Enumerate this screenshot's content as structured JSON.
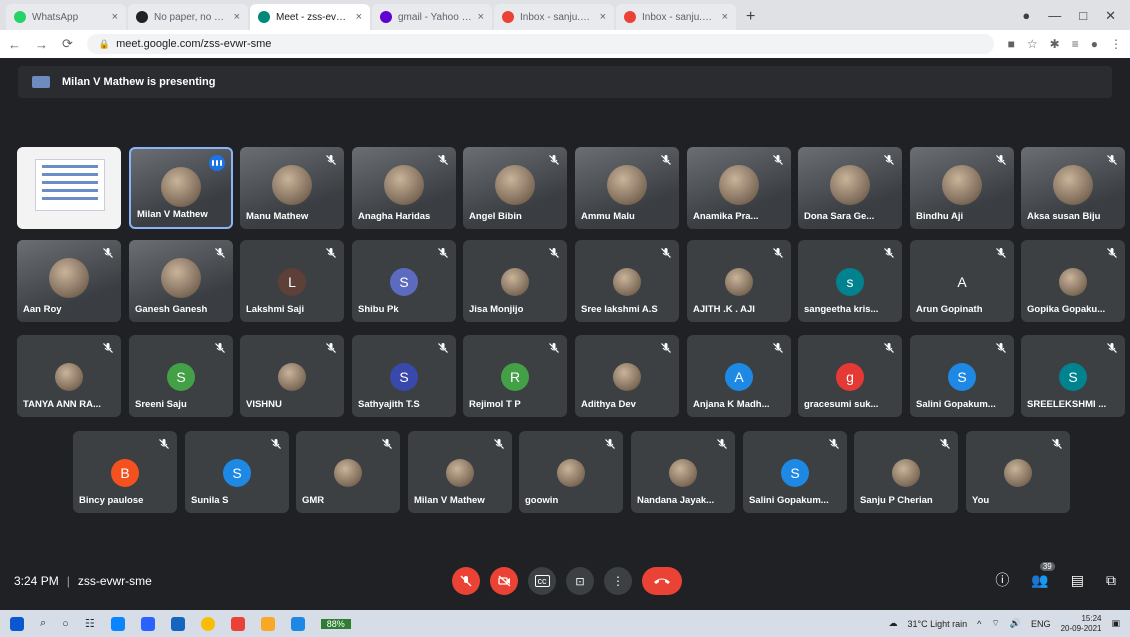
{
  "browser": {
    "tabs": [
      {
        "title": "WhatsApp",
        "favicon_color": "#25d366",
        "active": false
      },
      {
        "title": "No paper, no FAQ? India n...",
        "favicon_color": "#202124",
        "active": false
      },
      {
        "title": "Meet - zss-evwr-sme",
        "favicon_color": "#00897b",
        "active": true
      },
      {
        "title": "gmail - Yahoo India Search",
        "favicon_color": "#5f01d1",
        "active": false
      },
      {
        "title": "Inbox - sanju.p@saintgits...",
        "favicon_color": "#ea4335",
        "active": false
      },
      {
        "title": "Inbox - sanju.p@saintgits...",
        "favicon_color": "#ea4335",
        "active": false
      }
    ],
    "new_tab": "+",
    "url": "meet.google.com/zss-evwr-sme"
  },
  "presenting": {
    "text": "Milan V Mathew is presenting"
  },
  "participants": [
    {
      "name": "",
      "type": "presentation"
    },
    {
      "name": "Milan V Mathew",
      "type": "video-self",
      "speaking": true
    },
    {
      "name": "Manu Mathew",
      "type": "video",
      "muted": true
    },
    {
      "name": "Anagha Haridas",
      "type": "video",
      "muted": true
    },
    {
      "name": "Angel Bibin",
      "type": "video",
      "muted": true
    },
    {
      "name": "Ammu Malu",
      "type": "video",
      "muted": true
    },
    {
      "name": "Anamika Pra...",
      "type": "video",
      "muted": true
    },
    {
      "name": "Dona Sara Ge...",
      "type": "video",
      "muted": true
    },
    {
      "name": "Bindhu Aji",
      "type": "video",
      "muted": true
    },
    {
      "name": "Aksa susan Biju",
      "type": "video",
      "muted": true
    },
    {
      "name": "Aan Roy",
      "type": "video",
      "muted": true
    },
    {
      "name": "Ganesh Ganesh",
      "type": "video",
      "muted": true
    },
    {
      "name": "Lakshmi Saji",
      "type": "avatar",
      "initial": "L",
      "color": "#5d4037",
      "muted": true
    },
    {
      "name": "Shibu Pk",
      "type": "avatar",
      "initial": "S",
      "color": "#5c6bc0",
      "muted": true
    },
    {
      "name": "Jisa Monjijo",
      "type": "photo",
      "muted": true
    },
    {
      "name": "Sree lakshmi A.S",
      "type": "photo",
      "muted": true
    },
    {
      "name": "AJITH .K . AJI",
      "type": "photo",
      "muted": true
    },
    {
      "name": "sangeetha kris...",
      "type": "avatar",
      "initial": "s",
      "color": "#00838f",
      "muted": true
    },
    {
      "name": "Arun Gopinath",
      "type": "avatar",
      "initial": "A",
      "color": "#3c4043",
      "muted": true
    },
    {
      "name": "Gopika Gopaku...",
      "type": "photo",
      "muted": true
    },
    {
      "name": "TANYA ANN RA...",
      "type": "photo",
      "muted": true
    },
    {
      "name": "Sreeni Saju",
      "type": "avatar",
      "initial": "S",
      "color": "#43a047",
      "muted": true
    },
    {
      "name": "VISHNU",
      "type": "photo",
      "muted": true
    },
    {
      "name": "Sathyajith T.S",
      "type": "avatar",
      "initial": "S",
      "color": "#3949ab",
      "muted": true
    },
    {
      "name": "Rejimol T P",
      "type": "avatar",
      "initial": "R",
      "color": "#43a047",
      "muted": true
    },
    {
      "name": "Adithya Dev",
      "type": "photo",
      "muted": true
    },
    {
      "name": "Anjana K Madh...",
      "type": "avatar",
      "initial": "A",
      "color": "#1e88e5",
      "muted": true
    },
    {
      "name": "gracesumi suk...",
      "type": "avatar",
      "initial": "g",
      "color": "#e53935",
      "muted": true
    },
    {
      "name": "Salini Gopakum...",
      "type": "avatar",
      "initial": "S",
      "color": "#1e88e5",
      "muted": true
    },
    {
      "name": "SREELEKSHMI ...",
      "type": "avatar",
      "initial": "S",
      "color": "#00838f",
      "muted": true
    },
    {
      "name": "Bincy paulose",
      "type": "avatar",
      "initial": "B",
      "color": "#f4511e",
      "muted": true
    },
    {
      "name": "Sunila S",
      "type": "avatar",
      "initial": "S",
      "color": "#1e88e5",
      "muted": true
    },
    {
      "name": "GMR",
      "type": "photo",
      "muted": true
    },
    {
      "name": "Milan V Mathew",
      "type": "photo",
      "muted": true
    },
    {
      "name": "goowin",
      "type": "photo",
      "muted": true
    },
    {
      "name": "Nandana Jayak...",
      "type": "photo",
      "muted": true
    },
    {
      "name": "Salini Gopakum...",
      "type": "avatar",
      "initial": "S",
      "color": "#1e88e5",
      "muted": true
    },
    {
      "name": "Sanju P Cherian",
      "type": "photo",
      "muted": true
    },
    {
      "name": "You",
      "type": "photo",
      "muted": true
    }
  ],
  "footer": {
    "time": "3:24 PM",
    "meeting_code": "zss-evwr-sme",
    "participant_count": "39"
  },
  "taskbar": {
    "battery": "88%",
    "weather": "31°C  Light rain",
    "lang": "ENG",
    "time": "15:24",
    "date": "20-09-2021"
  }
}
